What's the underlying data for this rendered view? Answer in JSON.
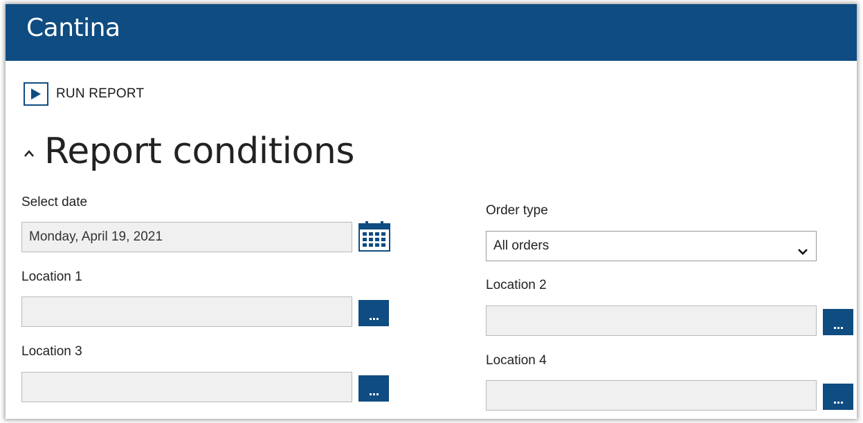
{
  "app": {
    "title": "Cantina",
    "brand_color": "#0f4c81"
  },
  "toolbar": {
    "run_report_label": "RUN REPORT",
    "run_icon": "play-icon"
  },
  "section": {
    "title": "Report conditions",
    "collapse_icon": "chevron-up-icon"
  },
  "fields": {
    "select_date": {
      "label": "Select date",
      "value": "Monday, April 19, 2021",
      "button_icon": "calendar-icon"
    },
    "order_type": {
      "label": "Order type",
      "value": "All orders",
      "button_icon": "chevron-down-icon"
    },
    "location_1": {
      "label": "Location 1",
      "value": "",
      "button_label": "..."
    },
    "location_2": {
      "label": "Location 2",
      "value": "",
      "button_label": "..."
    },
    "location_3": {
      "label": "Location 3",
      "value": "",
      "button_label": "..."
    },
    "location_4": {
      "label": "Location 4",
      "value": "",
      "button_label": "..."
    }
  }
}
